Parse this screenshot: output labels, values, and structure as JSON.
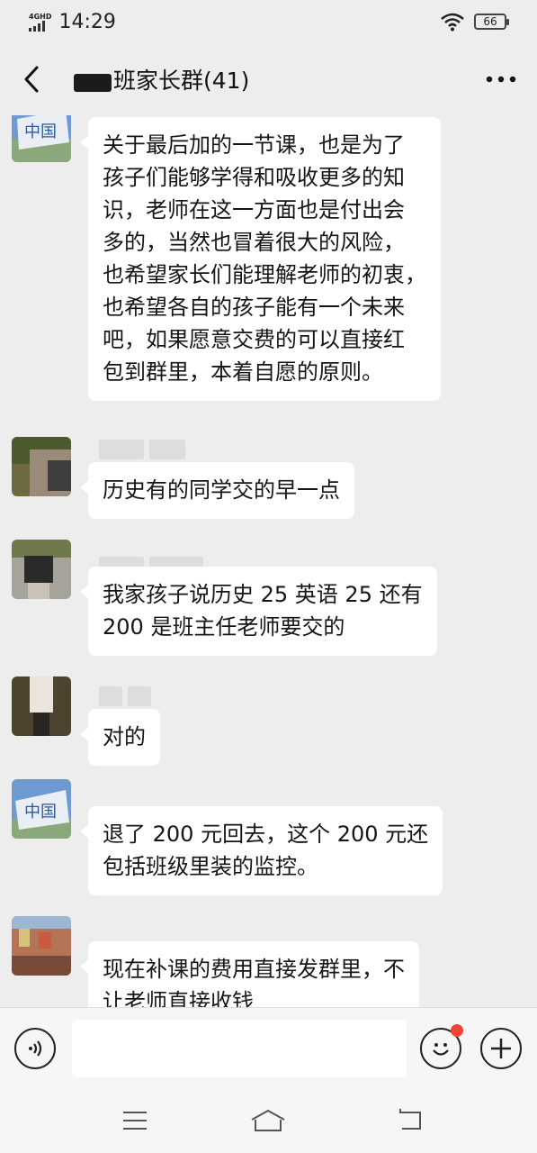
{
  "status_bar": {
    "network": "4GHD",
    "time": "14:29",
    "battery": "66"
  },
  "header": {
    "title": "班家长群(41)",
    "back_icon": "chevron-left-icon",
    "more_icon": "more-horizontal-icon"
  },
  "messages": [
    {
      "avatar": "sign-avatar",
      "text": "关于最后加的一节课，也是为了\n孩子们能够学得和吸收更多的知\n识，老师在这一方面也是付出会\n多的，当然也冒着很大的风险，\n也希望家长们能理解老师的初衷，\n也希望各自的孩子能有一个未来\n吧，如果愿意交费的可以直接红\n包到群里，本着自愿的原则。"
    },
    {
      "avatar": "person-avatar",
      "text": "历史有的同学交的早一点"
    },
    {
      "avatar": "person-avatar",
      "text": "我家孩子说历史 25 英语 25 还有\n200 是班主任老师要交的"
    },
    {
      "avatar": "person-avatar",
      "text": "对的"
    },
    {
      "avatar": "sign-avatar",
      "text": "退了 200 元回去，这个 200 元还\n包括班级里装的监控。"
    },
    {
      "avatar": "town-avatar",
      "text": "现在补课的费用直接发群里，不\n让老师直接收钱"
    }
  ],
  "input_bar": {
    "voice_icon": "voice-icon",
    "emoji_icon": "emoji-icon",
    "add_icon": "plus-icon",
    "input_value": ""
  },
  "system_nav": [
    "menu-icon",
    "home-icon",
    "back-icon"
  ],
  "colors": {
    "background": "#ededed",
    "bubble": "#ffffff",
    "badge": "#f44336"
  }
}
